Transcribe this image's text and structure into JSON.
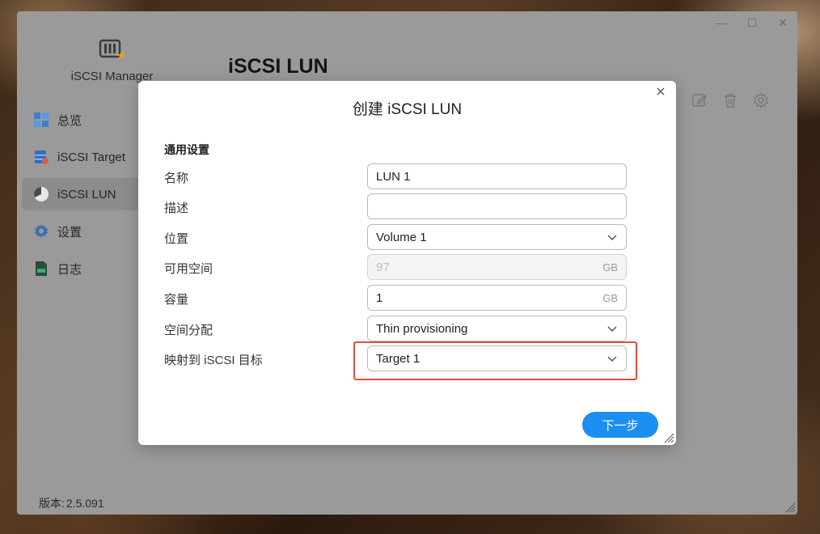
{
  "app": {
    "name": "iSCSI Manager",
    "page_title": "iSCSI LUN",
    "version_label": "版本:",
    "version_value": "2.5.091"
  },
  "window_controls": {
    "minimize": "—",
    "maximize": "☐",
    "close": "✕"
  },
  "sidebar": {
    "items": [
      {
        "label": "总览",
        "icon": "overview-grid-icon",
        "active": false
      },
      {
        "label": "iSCSI Target",
        "icon": "database-icon",
        "active": false
      },
      {
        "label": "iSCSI LUN",
        "icon": "pie-disk-icon",
        "active": true
      },
      {
        "label": "设置",
        "icon": "gear-icon",
        "active": false
      },
      {
        "label": "日志",
        "icon": "log-document-icon",
        "active": false
      }
    ]
  },
  "toolbar": {
    "icons": [
      "edit-icon",
      "trash-icon",
      "settings-icon"
    ]
  },
  "dialog": {
    "title": "创建 iSCSI LUN",
    "section": "通用设置",
    "fields": {
      "name": {
        "label": "名称",
        "value": "LUN 1"
      },
      "description": {
        "label": "描述",
        "value": ""
      },
      "location": {
        "label": "位置",
        "value": "Volume 1"
      },
      "available_space": {
        "label": "可用空间",
        "value": "97",
        "unit": "GB"
      },
      "capacity": {
        "label": "容量",
        "value": "1",
        "unit": "GB"
      },
      "space_allocation": {
        "label": "空间分配",
        "value": "Thin provisioning"
      },
      "map_to_target": {
        "label": "映射到 iSCSI 目标",
        "value": "Target 1"
      }
    },
    "next_label": "下一步"
  },
  "colors": {
    "accent": "#1a8ff0",
    "highlight": "#e64b3c"
  }
}
